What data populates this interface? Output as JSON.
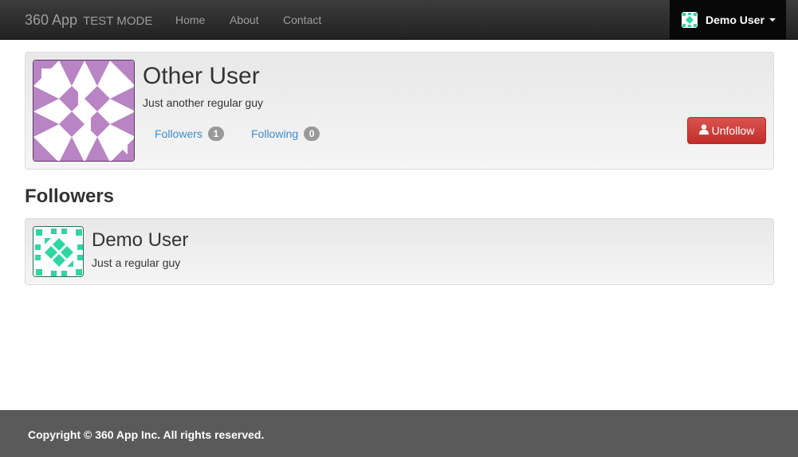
{
  "navbar": {
    "brand": "360 App",
    "mode": "TEST MODE",
    "links": [
      "Home",
      "About",
      "Contact"
    ],
    "user_name": "Demo User"
  },
  "profile": {
    "name": "Other User",
    "bio": "Just another regular guy",
    "followers_label": "Followers",
    "followers_count": "1",
    "following_label": "Following",
    "following_count": "0",
    "unfollow_label": "Unfollow",
    "avatar_color": "#b884c4"
  },
  "followers_section": {
    "title": "Followers",
    "items": [
      {
        "name": "Demo User",
        "bio": "Just a regular guy",
        "avatar_color": "#2fd6a4"
      }
    ]
  },
  "footer": {
    "text": "Copyright © 360 App Inc. All rights reserved."
  },
  "colors": {
    "navbar": "#222222",
    "link": "#428bca",
    "danger": "#d9534f",
    "footer": "#5a5a5a"
  }
}
